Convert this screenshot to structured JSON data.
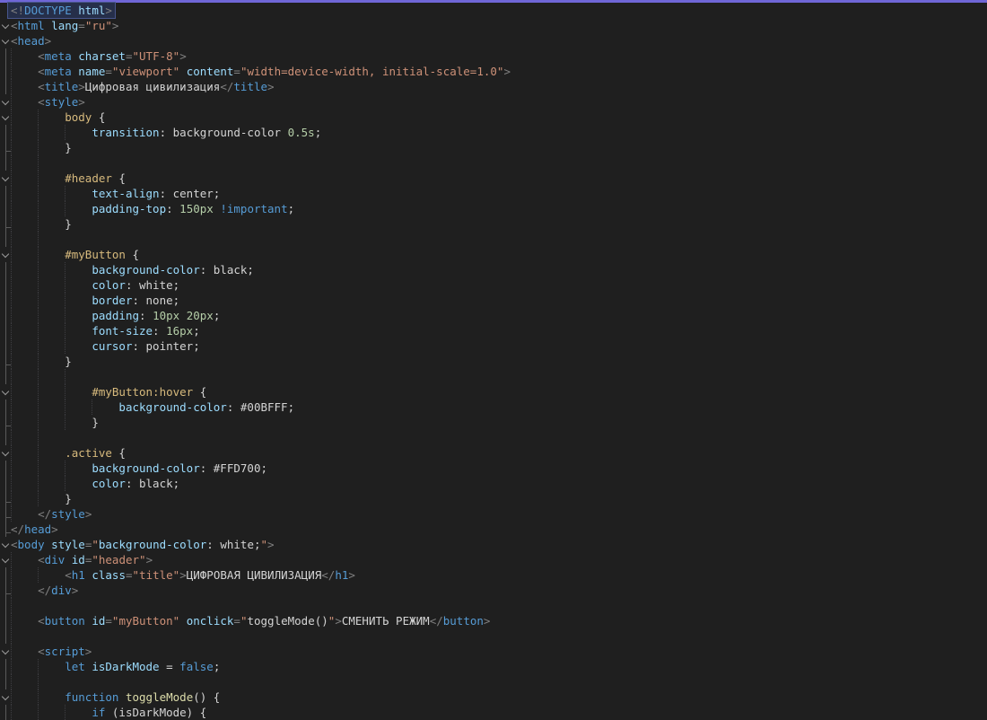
{
  "app": {
    "name": "code-editor-dark"
  },
  "editor": {
    "background": "#1f1f1f",
    "top_accent_color": "#6f66d6",
    "indent_guide_color": "#3e3e42",
    "gutter": {
      "outline_color": "#5a5a5a",
      "chevron_color": "#9b9b9b"
    },
    "current_line": {
      "background": "#262f4a",
      "border": "#48568c"
    },
    "palette": {
      "punct": "#808080",
      "tag": "#569cd6",
      "attr": "#9cdcfe",
      "string": "#ce9178",
      "text": "#d4d4d4",
      "selector": "#d7ba7d",
      "number": "#b5cea8",
      "keyword": "#569cd6",
      "func": "#dcdcaa"
    },
    "document_title": "Цифровая цивилизация",
    "lines": [
      {
        "fold": "none",
        "indent": 0,
        "guides": 0,
        "highlight": true,
        "tokens": [
          [
            "<!",
            "punct"
          ],
          [
            "DOCTYPE",
            "tag"
          ],
          [
            " html",
            "attr"
          ],
          [
            ">",
            "punct"
          ]
        ]
      },
      {
        "fold": "start",
        "indent": 0,
        "guides": 0,
        "tokens": [
          [
            "<",
            "punct"
          ],
          [
            "html",
            "tag"
          ],
          [
            " ",
            "text"
          ],
          [
            "lang",
            "attr"
          ],
          [
            "=",
            "punct"
          ],
          [
            "\"ru\"",
            "string"
          ],
          [
            ">",
            "punct"
          ]
        ]
      },
      {
        "fold": "start",
        "indent": 0,
        "guides": 0,
        "tokens": [
          [
            "<",
            "punct"
          ],
          [
            "head",
            "tag"
          ],
          [
            ">",
            "punct"
          ]
        ]
      },
      {
        "fold": "line",
        "indent": 4,
        "guides": 1,
        "tokens": [
          [
            "<",
            "punct"
          ],
          [
            "meta",
            "tag"
          ],
          [
            " ",
            "text"
          ],
          [
            "charset",
            "attr"
          ],
          [
            "=",
            "punct"
          ],
          [
            "\"UTF-8\"",
            "string"
          ],
          [
            ">",
            "punct"
          ]
        ]
      },
      {
        "fold": "line",
        "indent": 4,
        "guides": 1,
        "tokens": [
          [
            "<",
            "punct"
          ],
          [
            "meta",
            "tag"
          ],
          [
            " ",
            "text"
          ],
          [
            "name",
            "attr"
          ],
          [
            "=",
            "punct"
          ],
          [
            "\"viewport\"",
            "string"
          ],
          [
            " ",
            "text"
          ],
          [
            "content",
            "attr"
          ],
          [
            "=",
            "punct"
          ],
          [
            "\"width=device-width, initial-scale=1.0\"",
            "string"
          ],
          [
            ">",
            "punct"
          ]
        ]
      },
      {
        "fold": "line",
        "indent": 4,
        "guides": 1,
        "tokens": [
          [
            "<",
            "punct"
          ],
          [
            "title",
            "tag"
          ],
          [
            ">",
            "punct"
          ],
          [
            "Цифровая цивилизация",
            "text"
          ],
          [
            "</",
            "punct"
          ],
          [
            "title",
            "tag"
          ],
          [
            ">",
            "punct"
          ]
        ]
      },
      {
        "fold": "start",
        "indent": 4,
        "guides": 1,
        "tokens": [
          [
            "<",
            "punct"
          ],
          [
            "style",
            "tag"
          ],
          [
            ">",
            "punct"
          ]
        ]
      },
      {
        "fold": "start",
        "indent": 8,
        "guides": 2,
        "tokens": [
          [
            "body",
            "selector"
          ],
          [
            " {",
            "text"
          ]
        ]
      },
      {
        "fold": "line",
        "indent": 12,
        "guides": 3,
        "tokens": [
          [
            "transition",
            "attr"
          ],
          [
            ": ",
            "text"
          ],
          [
            "background-color ",
            "text"
          ],
          [
            "0.5s",
            "number"
          ],
          [
            ";",
            "text"
          ]
        ]
      },
      {
        "fold": "end",
        "indent": 8,
        "guides": 2,
        "tokens": [
          [
            "}",
            "text"
          ]
        ]
      },
      {
        "fold": "line",
        "indent": 0,
        "guides": 2,
        "tokens": []
      },
      {
        "fold": "start",
        "indent": 8,
        "guides": 2,
        "tokens": [
          [
            "#header",
            "selector"
          ],
          [
            " {",
            "text"
          ]
        ]
      },
      {
        "fold": "line",
        "indent": 12,
        "guides": 3,
        "tokens": [
          [
            "text-align",
            "attr"
          ],
          [
            ": center;",
            "text"
          ]
        ]
      },
      {
        "fold": "line",
        "indent": 12,
        "guides": 3,
        "tokens": [
          [
            "padding-top",
            "attr"
          ],
          [
            ": ",
            "text"
          ],
          [
            "150px",
            "number"
          ],
          [
            " ",
            "text"
          ],
          [
            "!important",
            "keyword"
          ],
          [
            ";",
            "text"
          ]
        ]
      },
      {
        "fold": "end",
        "indent": 8,
        "guides": 2,
        "tokens": [
          [
            "}",
            "text"
          ]
        ]
      },
      {
        "fold": "line",
        "indent": 0,
        "guides": 2,
        "tokens": []
      },
      {
        "fold": "start",
        "indent": 8,
        "guides": 2,
        "tokens": [
          [
            "#myButton",
            "selector"
          ],
          [
            " {",
            "text"
          ]
        ]
      },
      {
        "fold": "line",
        "indent": 12,
        "guides": 3,
        "tokens": [
          [
            "background-color",
            "attr"
          ],
          [
            ": black;",
            "text"
          ]
        ]
      },
      {
        "fold": "line",
        "indent": 12,
        "guides": 3,
        "tokens": [
          [
            "color",
            "attr"
          ],
          [
            ": white;",
            "text"
          ]
        ]
      },
      {
        "fold": "line",
        "indent": 12,
        "guides": 3,
        "tokens": [
          [
            "border",
            "attr"
          ],
          [
            ": none;",
            "text"
          ]
        ]
      },
      {
        "fold": "line",
        "indent": 12,
        "guides": 3,
        "tokens": [
          [
            "padding",
            "attr"
          ],
          [
            ": ",
            "text"
          ],
          [
            "10px",
            "number"
          ],
          [
            " ",
            "text"
          ],
          [
            "20px",
            "number"
          ],
          [
            ";",
            "text"
          ]
        ]
      },
      {
        "fold": "line",
        "indent": 12,
        "guides": 3,
        "tokens": [
          [
            "font-size",
            "attr"
          ],
          [
            ": ",
            "text"
          ],
          [
            "16px",
            "number"
          ],
          [
            ";",
            "text"
          ]
        ]
      },
      {
        "fold": "line",
        "indent": 12,
        "guides": 3,
        "tokens": [
          [
            "cursor",
            "attr"
          ],
          [
            ": pointer;",
            "text"
          ]
        ]
      },
      {
        "fold": "end",
        "indent": 8,
        "guides": 2,
        "tokens": [
          [
            "}",
            "text"
          ]
        ]
      },
      {
        "fold": "line",
        "indent": 0,
        "guides": 3,
        "tokens": []
      },
      {
        "fold": "start",
        "indent": 12,
        "guides": 3,
        "tokens": [
          [
            "#myButton:hover",
            "selector"
          ],
          [
            " {",
            "text"
          ]
        ]
      },
      {
        "fold": "line",
        "indent": 16,
        "guides": 4,
        "tokens": [
          [
            "background-color",
            "attr"
          ],
          [
            ": #00BFFF;",
            "text"
          ]
        ]
      },
      {
        "fold": "end",
        "indent": 12,
        "guides": 3,
        "tokens": [
          [
            "}",
            "text"
          ]
        ]
      },
      {
        "fold": "line",
        "indent": 0,
        "guides": 2,
        "tokens": []
      },
      {
        "fold": "start",
        "indent": 8,
        "guides": 2,
        "tokens": [
          [
            ".active",
            "selector"
          ],
          [
            " {",
            "text"
          ]
        ]
      },
      {
        "fold": "line",
        "indent": 12,
        "guides": 3,
        "tokens": [
          [
            "background-color",
            "attr"
          ],
          [
            ": #FFD700;",
            "text"
          ]
        ]
      },
      {
        "fold": "line",
        "indent": 12,
        "guides": 3,
        "tokens": [
          [
            "color",
            "attr"
          ],
          [
            ": black;",
            "text"
          ]
        ]
      },
      {
        "fold": "end",
        "indent": 8,
        "guides": 2,
        "tokens": [
          [
            "}",
            "text"
          ]
        ]
      },
      {
        "fold": "end",
        "indent": 4,
        "guides": 1,
        "tokens": [
          [
            "</",
            "punct"
          ],
          [
            "style",
            "tag"
          ],
          [
            ">",
            "punct"
          ]
        ]
      },
      {
        "fold": "end",
        "indent": 0,
        "guides": 0,
        "tokens": [
          [
            "</",
            "punct"
          ],
          [
            "head",
            "tag"
          ],
          [
            ">",
            "punct"
          ]
        ]
      },
      {
        "fold": "start",
        "indent": 0,
        "guides": 0,
        "tokens": [
          [
            "<",
            "punct"
          ],
          [
            "body",
            "tag"
          ],
          [
            " ",
            "text"
          ],
          [
            "style",
            "attr"
          ],
          [
            "=",
            "punct"
          ],
          [
            "\"",
            "string"
          ],
          [
            "background-color",
            "attr"
          ],
          [
            ": white;",
            "text"
          ],
          [
            "\"",
            "string"
          ],
          [
            ">",
            "punct"
          ]
        ]
      },
      {
        "fold": "start",
        "indent": 4,
        "guides": 1,
        "tokens": [
          [
            "<",
            "punct"
          ],
          [
            "div",
            "tag"
          ],
          [
            " ",
            "text"
          ],
          [
            "id",
            "attr"
          ],
          [
            "=",
            "punct"
          ],
          [
            "\"header\"",
            "string"
          ],
          [
            ">",
            "punct"
          ]
        ]
      },
      {
        "fold": "line",
        "indent": 8,
        "guides": 2,
        "tokens": [
          [
            "<",
            "punct"
          ],
          [
            "h1",
            "tag"
          ],
          [
            " ",
            "text"
          ],
          [
            "class",
            "attr"
          ],
          [
            "=",
            "punct"
          ],
          [
            "\"title\"",
            "string"
          ],
          [
            ">",
            "punct"
          ],
          [
            "ЦИФРОВАЯ ЦИВИЛИЗАЦИЯ",
            "text"
          ],
          [
            "</",
            "punct"
          ],
          [
            "h1",
            "tag"
          ],
          [
            ">",
            "punct"
          ]
        ]
      },
      {
        "fold": "end",
        "indent": 4,
        "guides": 1,
        "tokens": [
          [
            "</",
            "punct"
          ],
          [
            "div",
            "tag"
          ],
          [
            ">",
            "punct"
          ]
        ]
      },
      {
        "fold": "line",
        "indent": 0,
        "guides": 1,
        "tokens": []
      },
      {
        "fold": "line",
        "indent": 4,
        "guides": 1,
        "tokens": [
          [
            "<",
            "punct"
          ],
          [
            "button",
            "tag"
          ],
          [
            " ",
            "text"
          ],
          [
            "id",
            "attr"
          ],
          [
            "=",
            "punct"
          ],
          [
            "\"myButton\"",
            "string"
          ],
          [
            " ",
            "text"
          ],
          [
            "onclick",
            "attr"
          ],
          [
            "=",
            "punct"
          ],
          [
            "\"",
            "string"
          ],
          [
            "toggleMode()",
            "text"
          ],
          [
            "\"",
            "string"
          ],
          [
            ">",
            "punct"
          ],
          [
            "СМЕНИТЬ РЕЖИМ",
            "text"
          ],
          [
            "</",
            "punct"
          ],
          [
            "button",
            "tag"
          ],
          [
            ">",
            "punct"
          ]
        ]
      },
      {
        "fold": "line",
        "indent": 0,
        "guides": 1,
        "tokens": []
      },
      {
        "fold": "start",
        "indent": 4,
        "guides": 1,
        "tokens": [
          [
            "<",
            "punct"
          ],
          [
            "script",
            "tag"
          ],
          [
            ">",
            "punct"
          ]
        ]
      },
      {
        "fold": "line",
        "indent": 8,
        "guides": 2,
        "tokens": [
          [
            "let",
            "keyword"
          ],
          [
            " ",
            "text"
          ],
          [
            "isDarkMode",
            "attr"
          ],
          [
            " = ",
            "text"
          ],
          [
            "false",
            "keyword"
          ],
          [
            ";",
            "text"
          ]
        ]
      },
      {
        "fold": "line",
        "indent": 0,
        "guides": 2,
        "tokens": []
      },
      {
        "fold": "start",
        "indent": 8,
        "guides": 2,
        "tokens": [
          [
            "function",
            "keyword"
          ],
          [
            " ",
            "text"
          ],
          [
            "toggleMode",
            "func"
          ],
          [
            "() {",
            "text"
          ]
        ]
      },
      {
        "fold": "line",
        "indent": 12,
        "guides": 3,
        "tokens": [
          [
            "if",
            "keyword"
          ],
          [
            " (isDarkMode) {",
            "text"
          ]
        ]
      }
    ]
  }
}
